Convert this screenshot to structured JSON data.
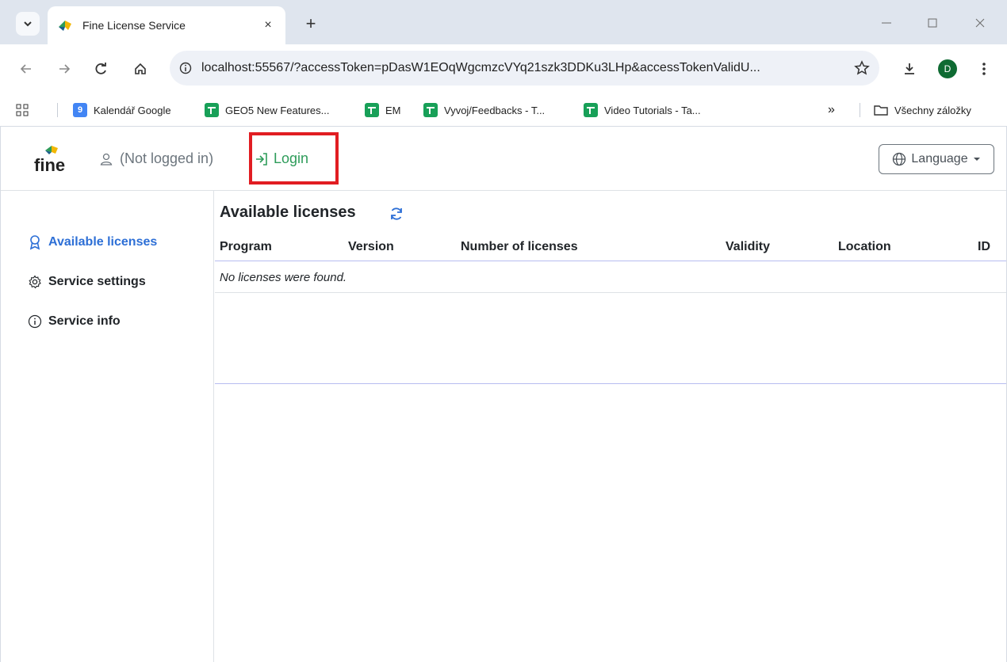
{
  "browser": {
    "tab_title": "Fine License Service",
    "tab_close": "×",
    "new_tab": "+",
    "url": "localhost:55567/?accessToken=pDasW1EOqWgcmzcVYq21szk3DDKu3LHp&accessTokenValidU...",
    "profile_initial": "D",
    "bookmarks": [
      {
        "label": "Kalendář Google",
        "icon": "google-calendar-icon",
        "badge": "9"
      },
      {
        "label": "GEO5 New Features...",
        "icon": "sheet-icon"
      },
      {
        "label": "EM",
        "icon": "sheet-icon"
      },
      {
        "label": "Vyvoj/Feedbacks - T...",
        "icon": "sheet-icon"
      },
      {
        "label": "Video Tutorials - Ta...",
        "icon": "sheet-icon"
      }
    ],
    "bookmarks_overflow": "»",
    "all_bookmarks": "Všechny záložky"
  },
  "app": {
    "brand": "fine",
    "user_status": "(Not logged in)",
    "login_label": "Login",
    "language_label": "Language",
    "sidebar": [
      {
        "label": "Available licenses",
        "icon": "award-icon",
        "active": true
      },
      {
        "label": "Service settings",
        "icon": "gear-icon",
        "active": false
      },
      {
        "label": "Service info",
        "icon": "info-icon",
        "active": false
      }
    ],
    "content": {
      "title": "Available licenses",
      "columns": [
        "Program",
        "Version",
        "Number of licenses",
        "Validity",
        "Location",
        "ID"
      ],
      "empty_message": "No licenses were found."
    },
    "colors": {
      "accent_blue": "#2d6fd6",
      "login_green": "#2e9c5a",
      "highlight_red": "#e11d22"
    }
  }
}
